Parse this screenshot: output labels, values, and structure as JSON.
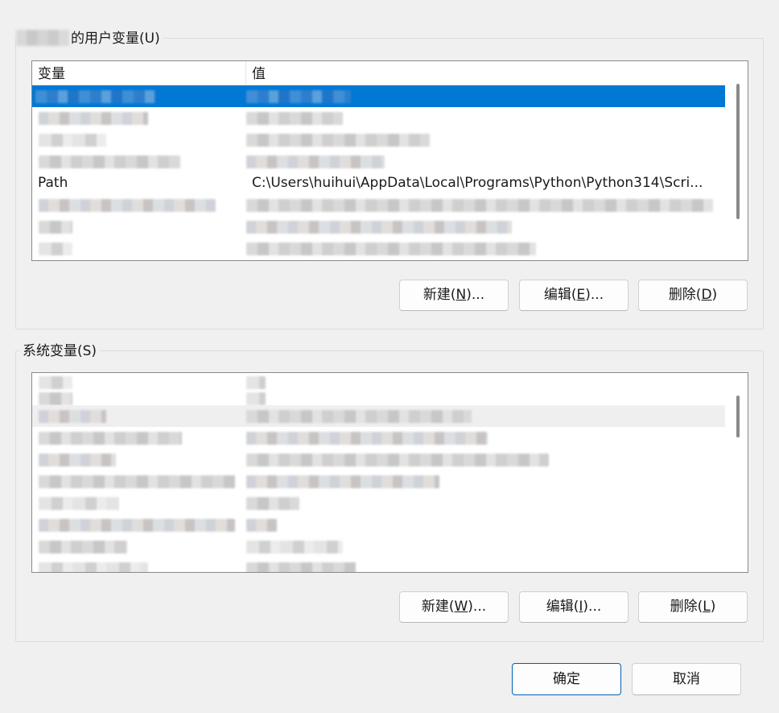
{
  "user_vars": {
    "title_visible": "的用户变量(U)",
    "columns": [
      "变量",
      "值"
    ],
    "path_row": {
      "name": "Path",
      "value": "C:\\Users\\huihui\\AppData\\Local\\Programs\\Python\\Python314\\Scri..."
    },
    "buttons": {
      "new_prefix": "新建(",
      "new_key": "N",
      "new_suffix": ")...",
      "edit_prefix": "编辑(",
      "edit_key": "E",
      "edit_suffix": ")...",
      "delete_prefix": "删除(",
      "delete_key": "D",
      "delete_suffix": ")"
    }
  },
  "system_vars": {
    "title": "系统变量(S)",
    "buttons": {
      "new_prefix": "新建(",
      "new_key": "W",
      "new_suffix": ")...",
      "edit_prefix": "编辑(",
      "edit_key": "I",
      "edit_suffix": ")...",
      "delete_prefix": "删除(",
      "delete_key": "L",
      "delete_suffix": ")"
    }
  },
  "footer": {
    "ok": "确定",
    "cancel": "取消"
  },
  "colors": {
    "selection": "#0078d4",
    "background": "#f0f0f0",
    "default_button_border": "#005fb8"
  }
}
